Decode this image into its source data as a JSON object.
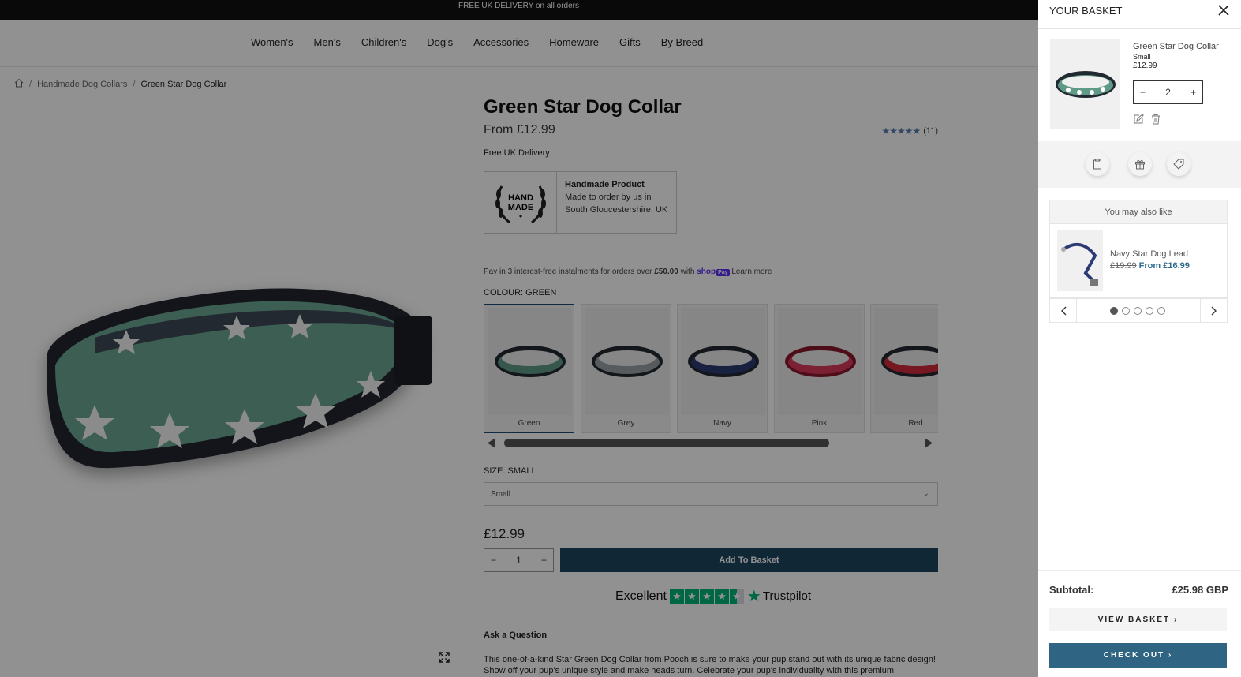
{
  "announcement": "FREE UK DELIVERY on all orders",
  "nav": [
    "Women's",
    "Men's",
    "Children's",
    "Dog's",
    "Accessories",
    "Homeware",
    "Gifts",
    "By Breed"
  ],
  "breadcrumb": {
    "home_icon": "home-icon",
    "sep": "/",
    "parent": "Handmade Dog Collars",
    "current": "Green Star Dog Collar"
  },
  "product": {
    "title": "Green Star Dog Collar",
    "from_price": "From £12.99",
    "rating_count": "(11)",
    "rating_stars": "★★★★★",
    "delivery": "Free UK Delivery",
    "handmade": {
      "logo_text_1": "HAND",
      "logo_text_2": "MADE",
      "heading": "Handmade Product",
      "line1": "Made to order by us in",
      "line2": "South Gloucestershire, UK"
    },
    "installments": {
      "text": "Pay in 3 interest-free instalments for orders over",
      "amount": "£50.00",
      "with": "with",
      "shop": "shop",
      "pay": "Pay",
      "learn": "Learn more"
    },
    "colour_label": "COLOUR: GREEN",
    "colours": [
      {
        "label": "Green",
        "color": "#5f9a86",
        "selected": true
      },
      {
        "label": "Grey",
        "color": "#9aa0a6",
        "selected": false
      },
      {
        "label": "Navy",
        "color": "#2c3a73",
        "selected": false
      },
      {
        "label": "Pink",
        "color": "#d93a5b",
        "selected": false
      },
      {
        "label": "Red",
        "color": "#cf2a3a",
        "selected": false
      }
    ],
    "size_label": "SIZE: SMALL",
    "size_value": "Small",
    "price": "£12.99",
    "qty": {
      "minus": "−",
      "value": "1",
      "plus": "+"
    },
    "add_to_basket": "Add To Basket",
    "trustpilot": {
      "excellent": "Excellent",
      "brand": "Trustpilot"
    },
    "ask_question": "Ask a Question",
    "description": "This one-of-a-kind Star Green Dog Collar from Pooch is sure to make your pup stand out with its unique fabric design! Show off your pup's unique style and make heads turn. Celebrate your pup's individuality with this premium"
  },
  "basket": {
    "title": "YOUR BASKET",
    "item": {
      "name": "Green Star Dog Collar",
      "variant": "Small",
      "price": "£12.99",
      "qty": "2",
      "minus": "−",
      "plus": "+"
    },
    "you_may_also_like": "You may also like",
    "suggestion": {
      "name": "Navy Star Dog Lead",
      "old_price": "£19.99",
      "new_price": "From £16.99"
    },
    "carousel": {
      "total_dots": 5,
      "active_dot": 1
    },
    "subtotal_label": "Subtotal:",
    "subtotal_value": "£25.98 GBP",
    "view_basket": "VIEW BASKET",
    "checkout": "CHECK OUT"
  },
  "colors": {
    "accent": "#1d4560",
    "checkout": "#2f6583",
    "trustpilot": "#00b67a"
  }
}
